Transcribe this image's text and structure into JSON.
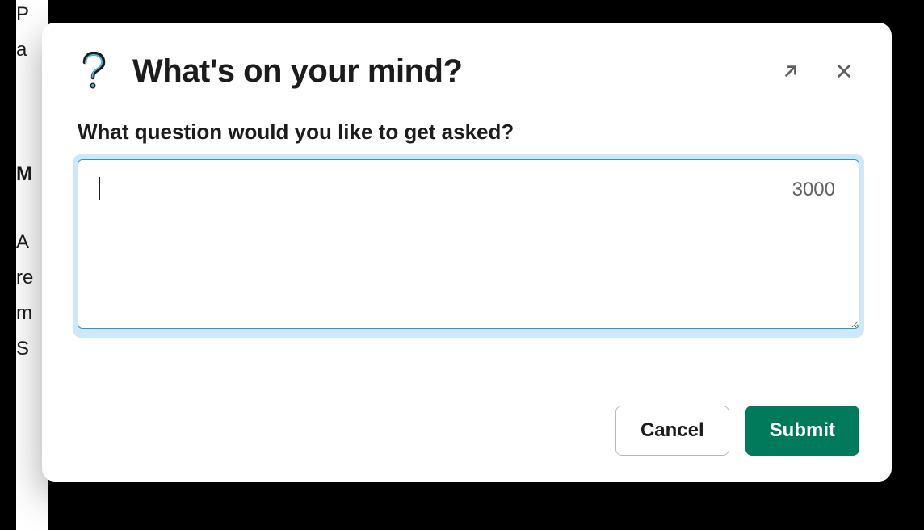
{
  "modal": {
    "title": "What's on your mind?",
    "field_label": "What question would you like to get asked?",
    "textarea_value": "",
    "char_limit": "3000",
    "cancel_label": "Cancel",
    "submit_label": "Submit"
  },
  "icons": {
    "question": "question-mark-icon",
    "expand": "expand-arrow-icon",
    "close": "close-icon"
  },
  "background_fragments": [
    "P",
    "a",
    "M",
    "A",
    "re",
    "m",
    "S"
  ]
}
